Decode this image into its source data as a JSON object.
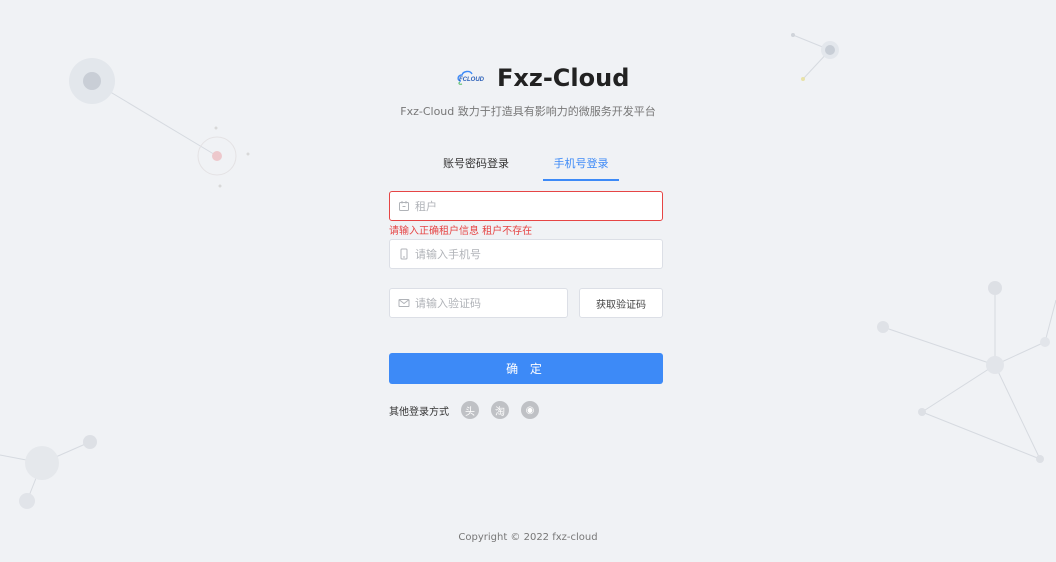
{
  "brand": {
    "logo_text": "FCLOUD",
    "title": "Fxz-Cloud",
    "subtitle": "Fxz-Cloud 致力于打造具有影响力的微服务开发平台"
  },
  "tabs": [
    {
      "label": "账号密码登录",
      "active": false
    },
    {
      "label": "手机号登录",
      "active": true
    }
  ],
  "form": {
    "tenant": {
      "placeholder": "租户",
      "value": "",
      "icon": "calendar-icon"
    },
    "tenant_error": "请输入正确租户信息 租户不存在",
    "phone": {
      "placeholder": "请输入手机号",
      "value": "",
      "icon": "mobile-icon"
    },
    "code": {
      "placeholder": "请输入验证码",
      "value": "",
      "icon": "mail-icon"
    },
    "get_code_label": "获取验证码",
    "submit_label": "确 定"
  },
  "other_login": {
    "label": "其他登录方式",
    "providers": [
      {
        "name": "toutiao",
        "glyph": "头",
        "icon": "toutiao-icon"
      },
      {
        "name": "taobao",
        "glyph": "淘",
        "icon": "taobao-icon"
      },
      {
        "name": "weibo",
        "glyph": "◉",
        "icon": "weibo-icon"
      }
    ]
  },
  "footer": {
    "copyright": "Copyright © 2022 fxz-cloud"
  },
  "colors": {
    "background": "#f0f2f5",
    "primary": "#3d8af7",
    "error": "#e64545"
  }
}
